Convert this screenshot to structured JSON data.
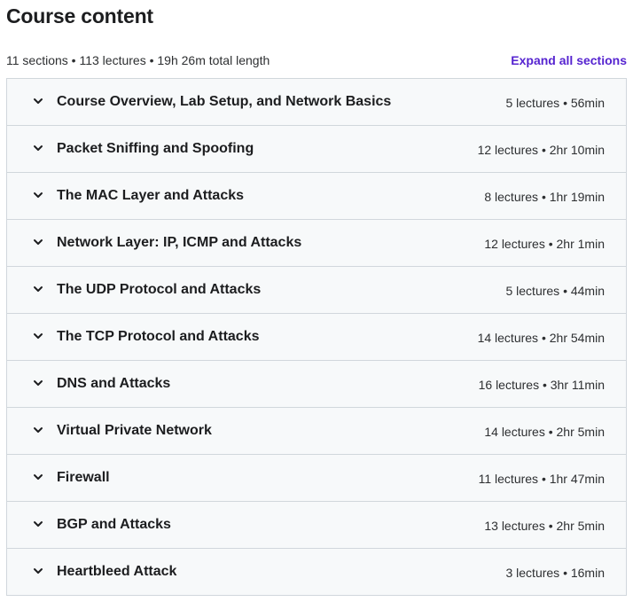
{
  "header": {
    "title": "Course content",
    "summary": "11 sections • 113 lectures • 19h 26m total length",
    "expand_all_label": "Expand all sections"
  },
  "sections": [
    {
      "title": "Course Overview, Lab Setup, and Network Basics",
      "meta": "5 lectures • 56min",
      "icon": "chevron-down-icon"
    },
    {
      "title": "Packet Sniffing and Spoofing",
      "meta": "12 lectures • 2hr 10min",
      "icon": "chevron-down-icon"
    },
    {
      "title": "The MAC Layer and Attacks",
      "meta": "8 lectures • 1hr 19min",
      "icon": "chevron-down-icon"
    },
    {
      "title": "Network Layer: IP, ICMP and Attacks",
      "meta": "12 lectures • 2hr 1min",
      "icon": "chevron-down-icon"
    },
    {
      "title": "The UDP Protocol and Attacks",
      "meta": "5 lectures • 44min",
      "icon": "chevron-down-icon"
    },
    {
      "title": "The TCP Protocol and Attacks",
      "meta": "14 lectures • 2hr 54min",
      "icon": "chevron-down-icon"
    },
    {
      "title": "DNS and Attacks",
      "meta": "16 lectures • 3hr 11min",
      "icon": "chevron-down-icon"
    },
    {
      "title": "Virtual Private Network",
      "meta": "14 lectures • 2hr 5min",
      "icon": "chevron-down-icon"
    },
    {
      "title": "Firewall",
      "meta": "11 lectures • 1hr 47min",
      "icon": "chevron-down-icon"
    },
    {
      "title": "BGP and Attacks",
      "meta": "13 lectures • 2hr 5min",
      "icon": "chevron-down-icon"
    },
    {
      "title": "Heartbleed Attack",
      "meta": "3 lectures • 16min",
      "icon": "chevron-down-icon"
    }
  ],
  "colors": {
    "link": "#5624d0",
    "section_bg": "#f7f9fa",
    "border": "#d1d7dc",
    "text": "#1c1d1f"
  }
}
